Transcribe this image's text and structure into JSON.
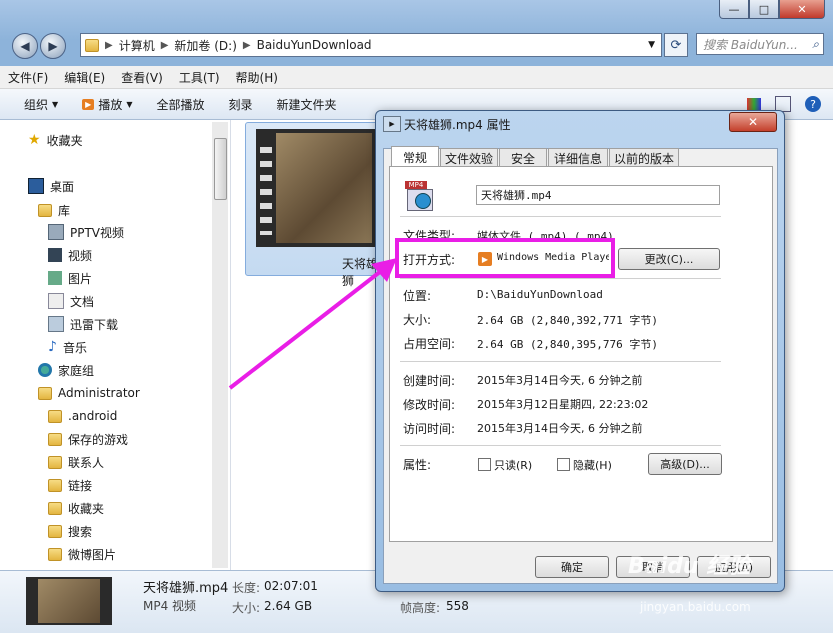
{
  "window": {
    "min": "—",
    "max": "□",
    "close": "✕"
  },
  "address": {
    "crumbs": [
      "计算机",
      "新加卷 (D:)",
      "BaiduYunDownload"
    ],
    "search_placeholder": "搜索 BaiduYun..."
  },
  "menubar": [
    "文件(F)",
    "编辑(E)",
    "查看(V)",
    "工具(T)",
    "帮助(H)"
  ],
  "toolbar": {
    "organize": "组织",
    "play": "播放",
    "play_all": "全部播放",
    "burn": "刻录",
    "new_folder": "新建文件夹"
  },
  "sidebar": {
    "favorites": "收藏夹",
    "desktop": "桌面",
    "library": "库",
    "library_items": [
      "PPTV视频",
      "视频",
      "图片",
      "文档",
      "迅雷下载",
      "音乐"
    ],
    "homegroup": "家庭组",
    "admin": "Administrator",
    "admin_items": [
      ".android",
      "保存的游戏",
      "联系人",
      "链接",
      "收藏夹",
      "搜索",
      "微博图片"
    ]
  },
  "file": {
    "thumb_label": "天将雄狮"
  },
  "details": {
    "name": "天将雄狮.mp4",
    "length_label": "长度:",
    "length": "02:07:01",
    "type": "MP4 视频",
    "size_label": "大小:",
    "size": "2.64 GB",
    "framew_label": "帧高度:",
    "frame_height": "558"
  },
  "dialog": {
    "title": "天将雄狮.mp4 属性",
    "close": "✕",
    "tabs": [
      "常规",
      "文件效验",
      "安全",
      "详细信息",
      "以前的版本"
    ],
    "icon_text": "MP4",
    "filename": "天将雄狮.mp4",
    "type_label": "文件类型:",
    "type_value": "媒体文件 (.mp4) (.mp4)",
    "open_label": "打开方式:",
    "open_value": "Windows Media Playe",
    "change_btn": "更改(C)...",
    "loc_label": "位置:",
    "loc_value": "D:\\BaiduYunDownload",
    "size_label": "大小:",
    "size_value": "2.64 GB (2,840,392,771 字节)",
    "disk_label": "占用空间:",
    "disk_value": "2.64 GB (2,840,395,776 字节)",
    "created_label": "创建时间:",
    "created_value": "2015年3月14日今天, 6 分钟之前",
    "modified_label": "修改时间:",
    "modified_value": "2015年3月12日星期四, 22:23:02",
    "accessed_label": "访问时间:",
    "accessed_value": "2015年3月14日今天, 6 分钟之前",
    "attr_label": "属性:",
    "readonly": "只读(R)",
    "hidden": "隐藏(H)",
    "advanced_btn": "高级(D)...",
    "ok": "确定",
    "cancel": "取消",
    "apply": "应用(A)"
  },
  "watermark": {
    "brand": "Baidu 经验",
    "url": "jingyan.baidu.com"
  },
  "colors": {
    "highlight": "#e91ee6"
  }
}
